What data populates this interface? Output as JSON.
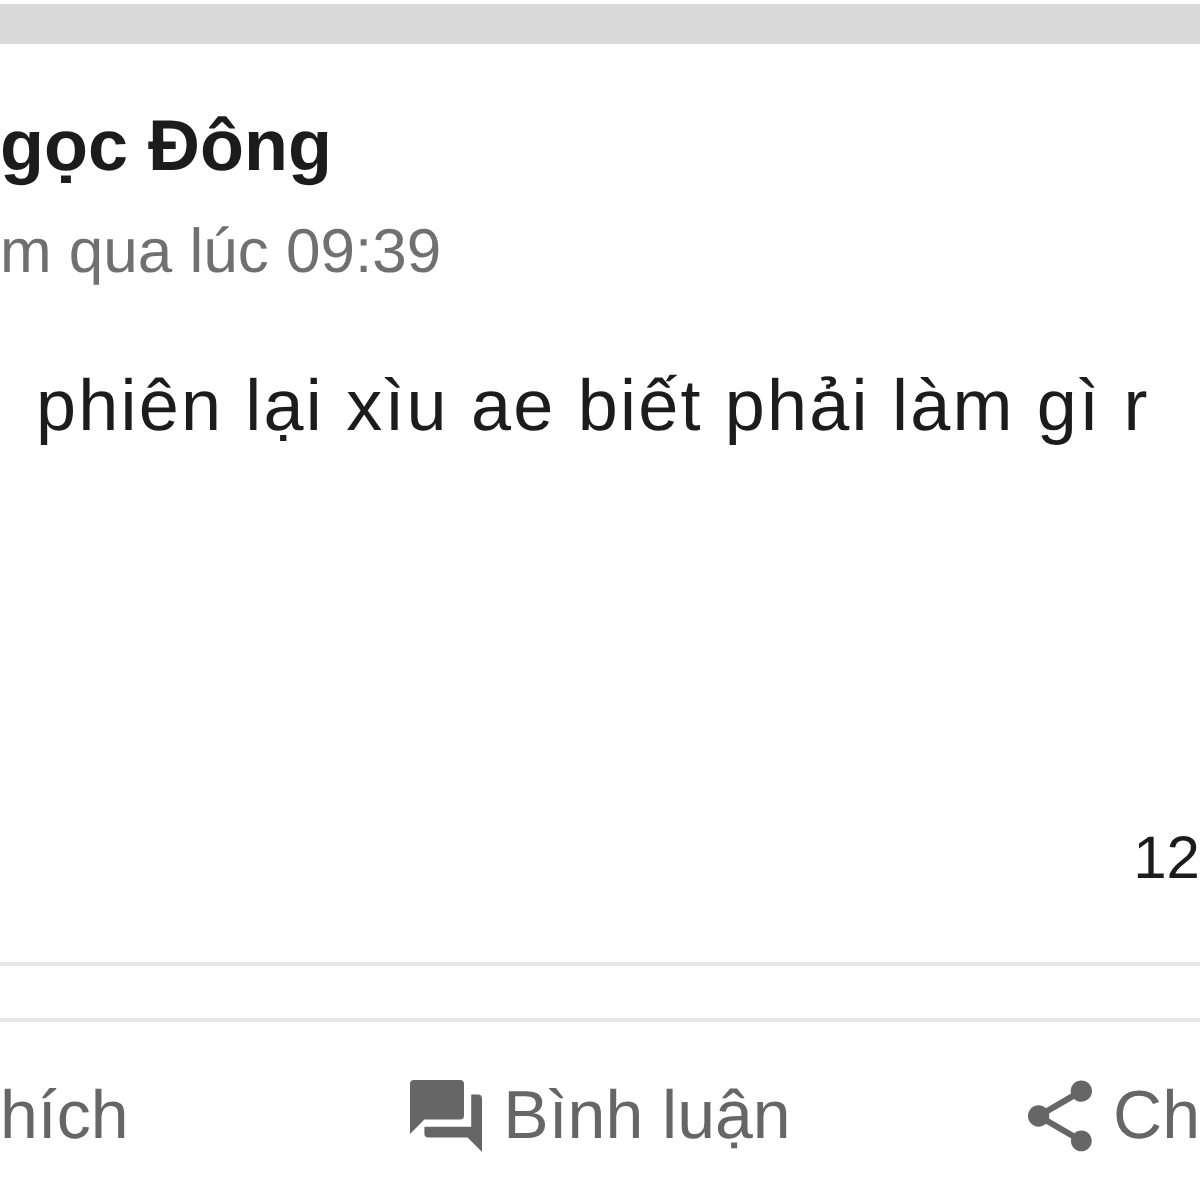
{
  "post": {
    "author": "gọc Đông",
    "time": "m qua lúc 09:39",
    "text": "phiên lại xìu ae biết phải làm gì r",
    "count": "12"
  },
  "actions": [
    {
      "kind": "like",
      "label": "hích"
    },
    {
      "kind": "comment",
      "label": "Bình luận"
    },
    {
      "kind": "share",
      "label": "Ch"
    }
  ]
}
